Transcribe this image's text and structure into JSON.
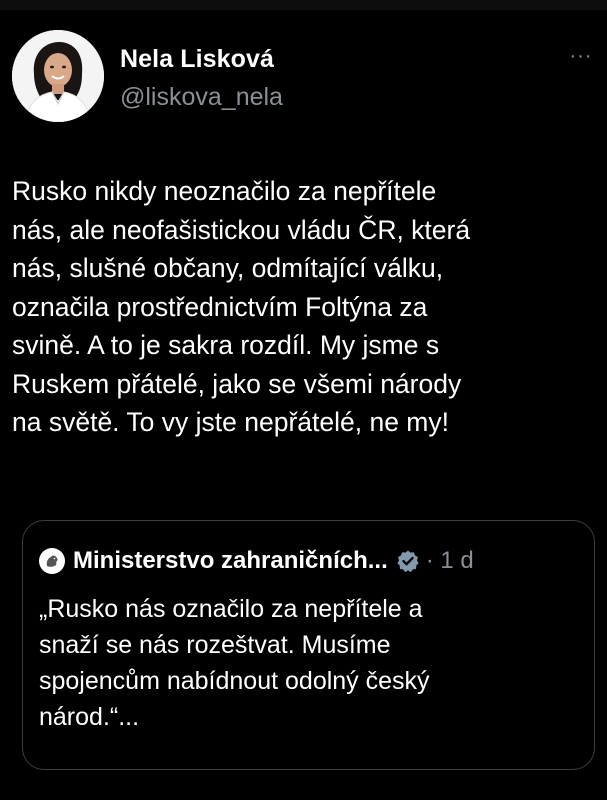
{
  "author": {
    "display_name": "Nela Lisková",
    "handle": "@liskova_nela"
  },
  "menu": {
    "more_label": "···"
  },
  "tweet": {
    "text": "Rusko nikdy neoznačilo za nepřítele\nnás, ale neofašistickou vládu ČR, která\nnás, slušné občany, odmítající válku,\noznačila prostřednictvím Foltýna za\nsvině. A to je sakra rozdíl. My jsme s\nRuskem přátelé, jako se všemi národy\nna světě. To vy jste nepřátelé, ne my!"
  },
  "quoted_tweet": {
    "author_name": "Ministerstvo zahraničních...",
    "verified_icon": "verified-badge-icon",
    "time": "· 1 d",
    "text": "„Rusko nás označilo za nepřítele a\nsnaží se nás rozeštvat. Musíme\nspojencům nabídnout odolný český\nnárod.“..."
  },
  "colors": {
    "background": "#000000",
    "text": "#ffffff",
    "secondary_text": "#8b9096",
    "border": "#3a3d41",
    "verified_badge": "#829aab"
  }
}
